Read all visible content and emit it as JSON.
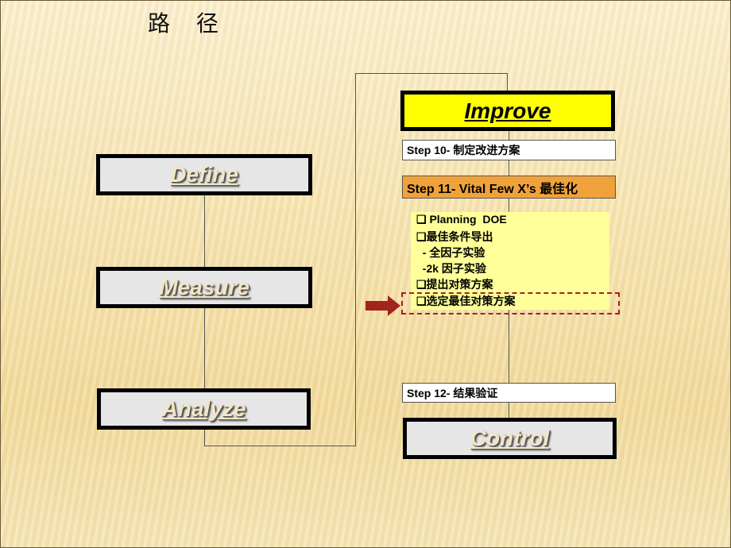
{
  "title": "路 径",
  "phases": {
    "define": "Define",
    "measure": "Measure",
    "analyze": "Analyze",
    "improve": "Improve",
    "control": "Control"
  },
  "steps": {
    "step10": "Step 10- 制定改进方案",
    "step11": "Step 11- Vital Few X’s 最佳化",
    "step12": "Step 12- 结果验证"
  },
  "checklist": [
    "❑ Planning  DOE",
    "❑最佳条件导出",
    "  - 全因子实验",
    "  -2k 因子实验",
    "❑提出对策方案",
    "❑选定最佳对策方案"
  ],
  "highlight": {
    "item_index": 5,
    "arrow_color": "#a3231f",
    "dash_color": "#a3231f"
  },
  "colors": {
    "improve_fill": "#ffff00",
    "step11_fill": "#f0a23a",
    "checklist_fill": "#ffff99",
    "phase_fill": "#e6e6e6"
  }
}
